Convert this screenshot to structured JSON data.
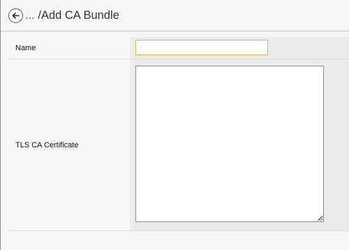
{
  "header": {
    "back_icon": "back-arrow-icon",
    "breadcrumb_link": "...",
    "breadcrumb_separator": "/",
    "breadcrumb_current": "Add CA Bundle"
  },
  "form": {
    "name": {
      "label": "Name",
      "value": ""
    },
    "tls_ca_certificate": {
      "label": "TLS CA Certificate",
      "value": ""
    }
  },
  "colors": {
    "link": "#1f6fb2",
    "focused_input_border": "#e8b54d"
  }
}
